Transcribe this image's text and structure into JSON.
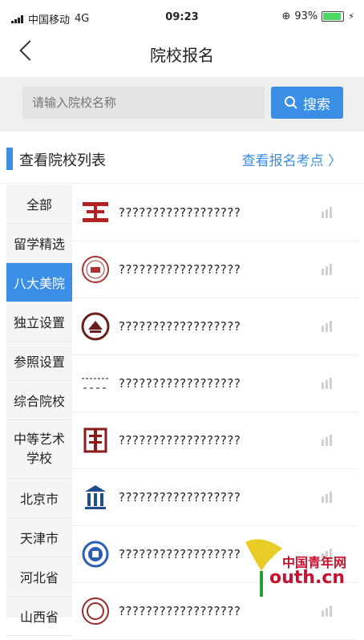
{
  "status": {
    "carrier": "中国移动",
    "network": "4G",
    "time": "09:23",
    "battery": "93%"
  },
  "nav": {
    "title": "院校报名"
  },
  "search": {
    "placeholder": "请输入院校名称",
    "button": "搜索"
  },
  "header": {
    "title": "查看院校列表",
    "link": "查看报名考点"
  },
  "categories": [
    {
      "label": "全部"
    },
    {
      "label": "留学精选"
    },
    {
      "label": "八大美院"
    },
    {
      "label": "独立设置"
    },
    {
      "label": "参照设置"
    },
    {
      "label": "综合院校"
    },
    {
      "label": "中等艺术学校"
    },
    {
      "label": "北京市"
    },
    {
      "label": "天津市"
    },
    {
      "label": "河北省"
    },
    {
      "label": "山西省"
    }
  ],
  "schools": [
    {
      "name": "??????????????????"
    },
    {
      "name": "??????????????????"
    },
    {
      "name": "??????????????????"
    },
    {
      "name": "??????????????????"
    },
    {
      "name": "??????????????????"
    },
    {
      "name": "??????????????????"
    },
    {
      "name": "??????????????????"
    },
    {
      "name": "??????????????????"
    }
  ],
  "watermark": {
    "brand": "中国青年网",
    "site": "outh.cn"
  },
  "colors": {
    "accent": "#3a8ee6",
    "header_bg": "#efefef",
    "sidebar_bg": "#f5f5f5"
  }
}
